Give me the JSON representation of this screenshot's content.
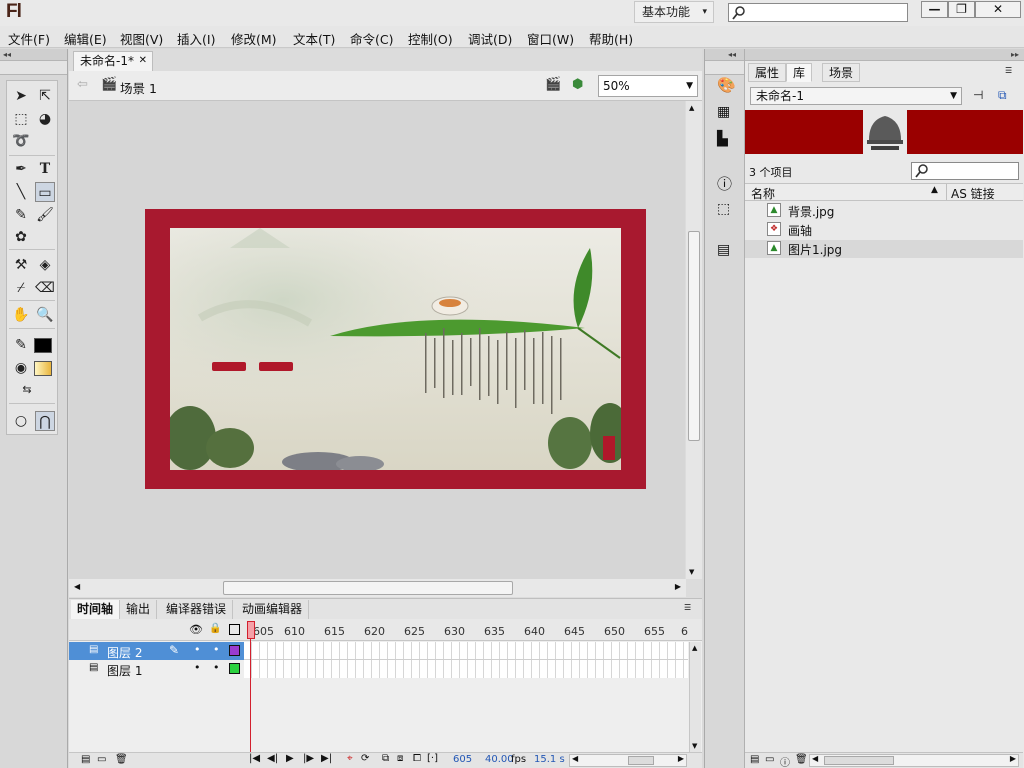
{
  "title_bar": {
    "app_logo": "Fl",
    "workspace_label": "基本功能"
  },
  "menu": [
    "文件(F)",
    "编辑(E)",
    "视图(V)",
    "插入(I)",
    "修改(M)",
    "文本(T)",
    "命令(C)",
    "控制(O)",
    "调试(D)",
    "窗口(W)",
    "帮助(H)"
  ],
  "document": {
    "tab_name": "未命名-1*",
    "scene_name": "场景 1",
    "zoom": "50%"
  },
  "timeline": {
    "tabs": [
      "时间轴",
      "输出",
      "编译器错误",
      "动画编辑器"
    ],
    "frame_numbers": [
      "605",
      "610",
      "615",
      "620",
      "625",
      "630",
      "635",
      "640",
      "645",
      "650",
      "655",
      "6"
    ],
    "layers": [
      {
        "name": "图层 2",
        "selected": true,
        "color": "#9b3bd0"
      },
      {
        "name": "图层 1",
        "selected": false,
        "color": "#2bd13f"
      }
    ],
    "status": {
      "current_frame": "605",
      "frame_rate": "40.00",
      "fps_unit": "fps",
      "elapsed": "15.1 s"
    }
  },
  "library": {
    "tabs": [
      "属性",
      "库",
      "场景"
    ],
    "document_select": "未命名-1",
    "item_count": "3 个项目",
    "col_name": "名称",
    "col_linkage": "AS 链接",
    "items": [
      {
        "name": "背景.jpg",
        "icon": "bitmap-icon"
      },
      {
        "name": "画轴",
        "icon": "movieclip-icon"
      },
      {
        "name": "图片1.jpg",
        "icon": "bitmap-icon"
      }
    ]
  },
  "colors": {
    "stage_frame": "#a8192f",
    "preview_bg": "#9a0000",
    "selected_layer": "#4f8fd6"
  }
}
